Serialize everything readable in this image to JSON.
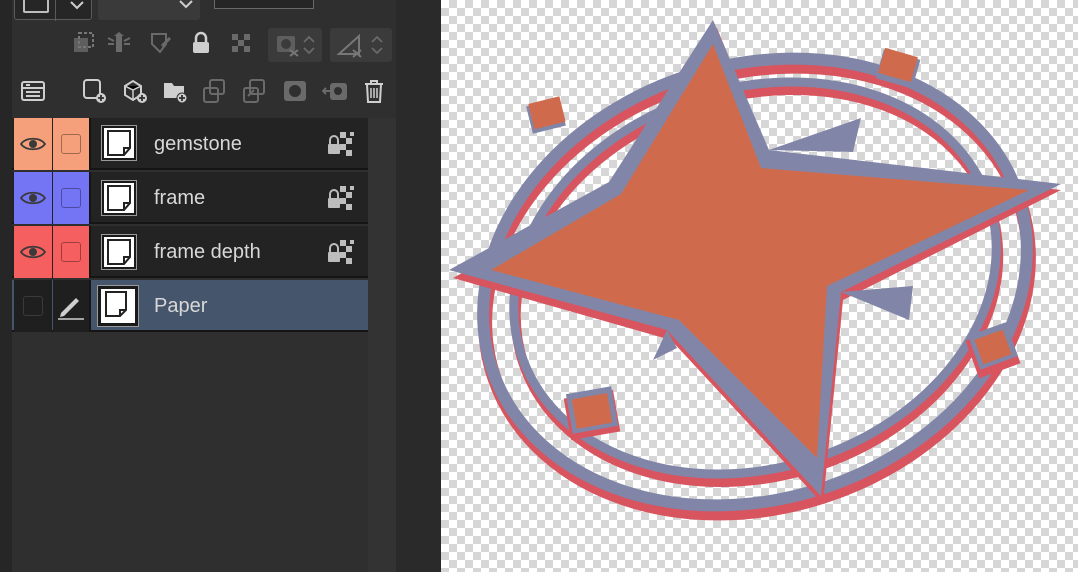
{
  "colors": {
    "gemstone": "#f5a07a",
    "frame": "#7375f5",
    "frame_depth": "#f55f5f",
    "selected_row": "#45556b",
    "artwork_orange": "#d06a4c",
    "artwork_gray": "#8186a8",
    "artwork_red": "#d8545e"
  },
  "toolbar_top_icons": [
    "clip-mask-icon",
    "reference-layer-icon",
    "draft-layer-icon",
    "lock-icon",
    "lock-transparency-icon",
    "mask-toggle-icon",
    "ruler-toggle-icon"
  ],
  "toolbar_layer_icons": [
    "layer-property-icon",
    "new-raster-layer-icon",
    "new-vector-layer-icon",
    "new-folder-icon",
    "transfer-below-icon",
    "combine-below-icon",
    "create-mask-icon",
    "apply-mask-icon",
    "delete-layer-icon"
  ],
  "layers": [
    {
      "name": "gemstone",
      "visible": true,
      "color": "#f5a07a"
    },
    {
      "name": "frame",
      "visible": true,
      "color": "#7375f5"
    },
    {
      "name": "frame depth",
      "visible": true,
      "color": "#f55f5f"
    },
    {
      "name": "Paper",
      "visible": false,
      "selected": true,
      "editing": true
    }
  ]
}
